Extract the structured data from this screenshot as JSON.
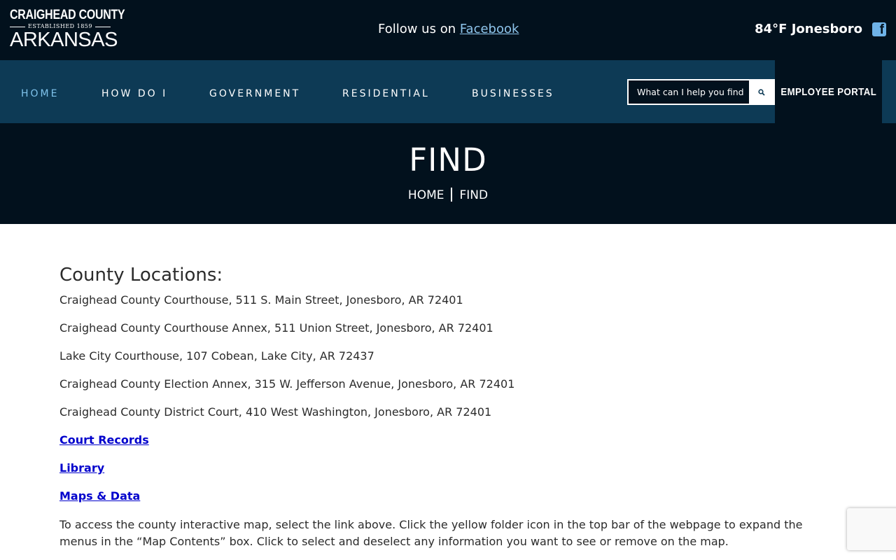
{
  "header": {
    "logo": {
      "line1": "CRAIGHEAD COUNTY",
      "established": "ESTABLISHED 1859",
      "line3": "ARKANSAS"
    },
    "follow_prefix": "Follow us on ",
    "follow_link": "Facebook",
    "weather": "84°F  Jonesboro",
    "facebook_icon_glyph": "f"
  },
  "nav": {
    "items": [
      {
        "label": "HOME",
        "active": true
      },
      {
        "label": "HOW DO I"
      },
      {
        "label": "GOVERNMENT"
      },
      {
        "label": "RESIDENTIAL"
      },
      {
        "label": "BUSINESSES"
      }
    ],
    "search_placeholder": "What can I help you find",
    "portal_label": "EMPLOYEE PORTAL"
  },
  "banner": {
    "title": "FIND",
    "breadcrumb": [
      "HOME",
      "FIND"
    ]
  },
  "content": {
    "heading": "County Locations:",
    "locations": [
      "Craighead County Courthouse, 511 S. Main Street, Jonesboro, AR 72401",
      "Craighead County Courthouse Annex, 511 Union Street, Jonesboro, AR 72401",
      "Lake City Courthouse, 107 Cobean, Lake City, AR 72437",
      "Craighead County Election Annex, 315 W. Jefferson Avenue, Jonesboro, AR 72401",
      "Craighead County District Court, 410 West Washington, Jonesboro, AR  72401"
    ],
    "links": [
      "Court Records",
      "Library",
      "Maps & Data"
    ],
    "paragraph": "To access the county interactive map, select the link above. Click the yellow folder icon in the top bar of the webpage to expand the menus in the “Map Contents” box. Click to select and deselect any information you want to see or remove on the map."
  },
  "colors": {
    "top_bg": "#02111d",
    "nav_bg": "#0d3a55",
    "nav_active": "#7fc3ec",
    "link": "#0000cc"
  }
}
